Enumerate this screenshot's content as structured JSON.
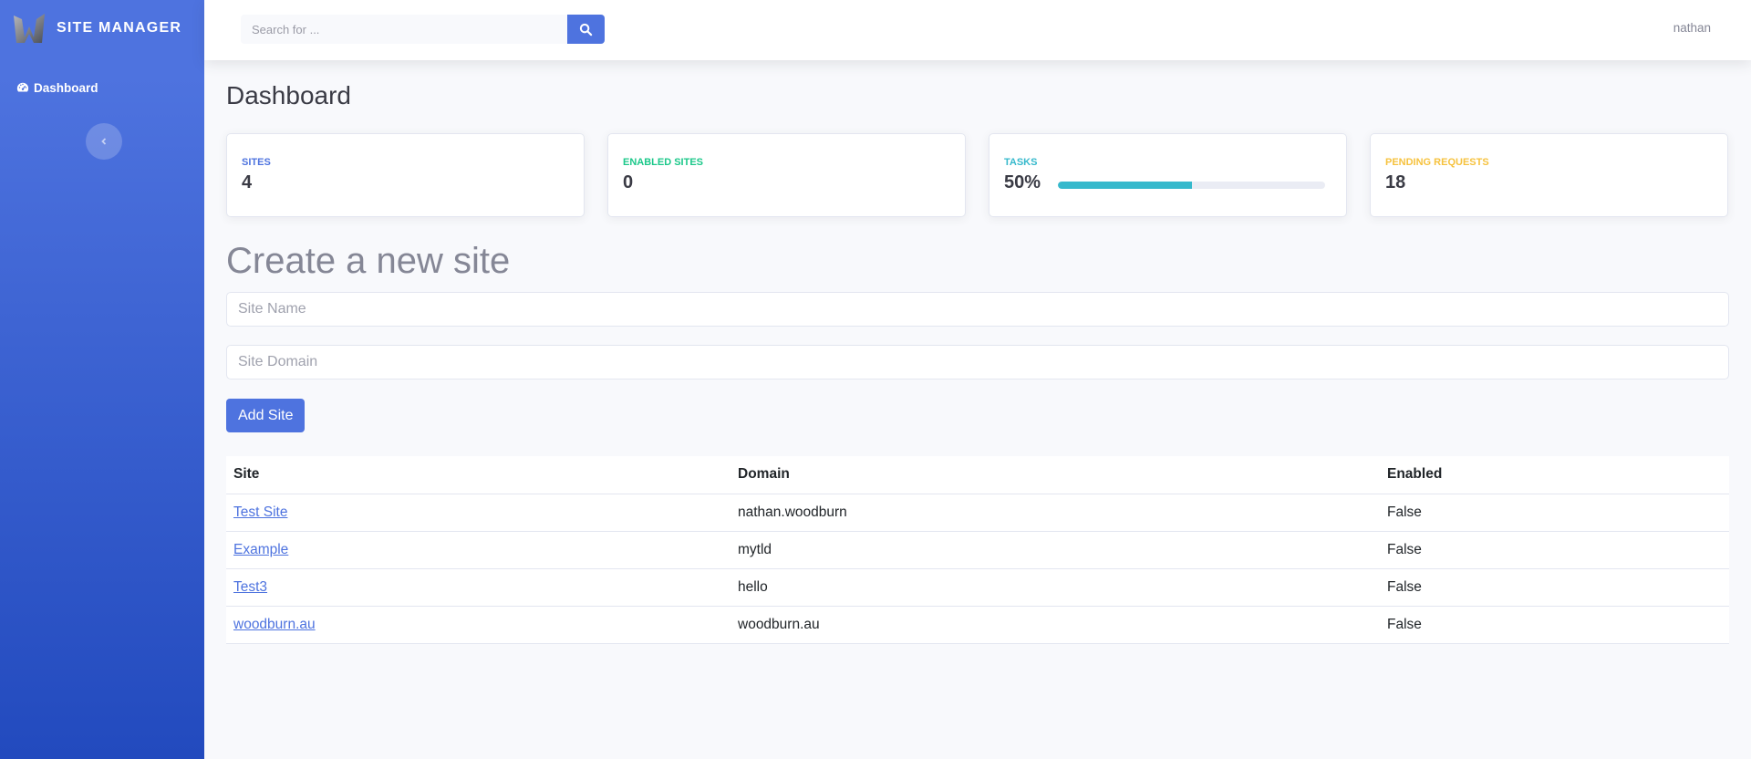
{
  "brand": {
    "name": "SITE MANAGER",
    "logo_icon": "w-logo"
  },
  "sidebar": {
    "items": [
      {
        "label": "Dashboard",
        "icon": "tachometer-icon"
      }
    ],
    "toggle_icon": "chevron-left-icon"
  },
  "topbar": {
    "search": {
      "placeholder": "Search for ...",
      "value": "",
      "button_icon": "search-icon"
    },
    "user": "nathan"
  },
  "page": {
    "title": "Dashboard"
  },
  "cards": [
    {
      "label": "Sites",
      "value": "4",
      "color": "#4e73df"
    },
    {
      "label": "Enabled Sites",
      "value": "0",
      "color": "#1cc88a"
    },
    {
      "label": "Tasks",
      "value": "50%",
      "progress": 50,
      "color": "#36b9cc"
    },
    {
      "label": "Pending Requests",
      "value": "18",
      "color": "#f6c23e"
    }
  ],
  "form": {
    "title": "Create a new site",
    "site_name": {
      "placeholder": "Site Name",
      "value": ""
    },
    "site_domain": {
      "placeholder": "Site Domain",
      "value": ""
    },
    "submit_label": "Add Site"
  },
  "table": {
    "headers": [
      "Site",
      "Domain",
      "Enabled"
    ],
    "rows": [
      {
        "site": "Test Site",
        "domain": "nathan.woodburn",
        "enabled": "False"
      },
      {
        "site": "Example",
        "domain": "mytld",
        "enabled": "False"
      },
      {
        "site": "Test3",
        "domain": "hello",
        "enabled": "False"
      },
      {
        "site": "woodburn.au",
        "domain": "woodburn.au",
        "enabled": "False"
      }
    ]
  },
  "colors": {
    "primary": "#4e73df",
    "success": "#1cc88a",
    "info": "#36b9cc",
    "warning": "#f6c23e"
  }
}
